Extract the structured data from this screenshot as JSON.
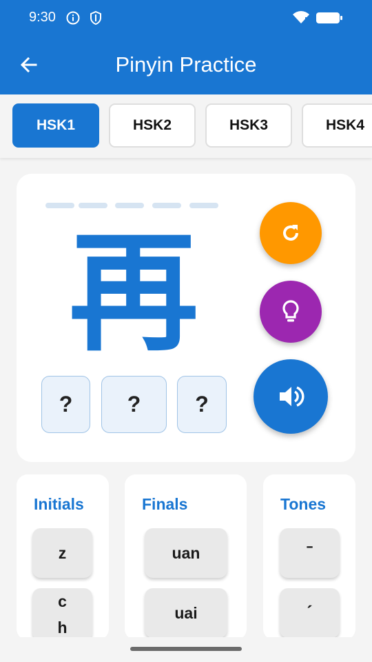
{
  "status_bar": {
    "time": "9:30"
  },
  "app_bar": {
    "title": "Pinyin Practice"
  },
  "tabs": [
    {
      "label": "HSK1",
      "active": true
    },
    {
      "label": "HSK2",
      "active": false
    },
    {
      "label": "HSK3",
      "active": false
    },
    {
      "label": "HSK4",
      "active": false
    }
  ],
  "practice": {
    "character": "再",
    "slots": [
      "?",
      "?",
      "?"
    ],
    "refresh_icon": "refresh-icon",
    "hint_icon": "lightbulb-icon",
    "audio_icon": "speaker-icon"
  },
  "initials": {
    "title": "Initials",
    "keys": [
      "z",
      "c\nh"
    ]
  },
  "finals": {
    "title": "Finals",
    "keys": [
      "uan",
      "uai"
    ]
  },
  "tones": {
    "title": "Tones",
    "keys": [
      "ˉ",
      "ˊ"
    ]
  },
  "colors": {
    "primary": "#1976d2",
    "refresh": "#ff9800",
    "hint": "#9c27b0"
  }
}
